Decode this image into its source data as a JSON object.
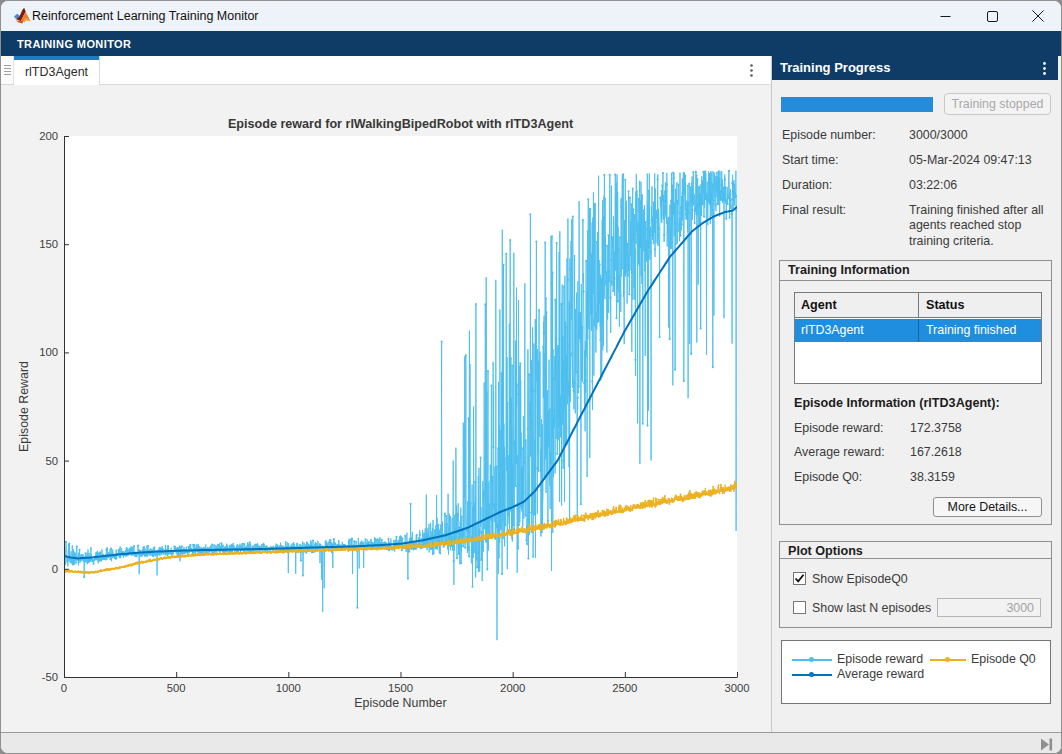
{
  "window": {
    "title": "Reinforcement Learning Training Monitor"
  },
  "toolstrip": {
    "tab_label": "TRAINING MONITOR"
  },
  "document_tab": {
    "label": "rlTD3Agent"
  },
  "right_panel": {
    "header": "Training Progress",
    "progress": {
      "percent": 100,
      "button_label": "Training stopped"
    },
    "fields": [
      {
        "label": "Episode number:",
        "value": "3000/3000"
      },
      {
        "label": "Start time:",
        "value": "05-Mar-2024 09:47:13"
      },
      {
        "label": "Duration:",
        "value": "03:22:06"
      },
      {
        "label": "Final result:",
        "value": "Training finished after all agents reached stop training criteria."
      }
    ],
    "training_information": {
      "title": "Training Information",
      "table": {
        "columns": [
          "Agent",
          "Status"
        ],
        "rows": [
          {
            "agent": "rlTD3Agent",
            "status": "Training finished",
            "selected": true
          }
        ]
      },
      "episode_info_title": "Episode Information (rlTD3Agent):",
      "stats": [
        {
          "label": "Episode reward:",
          "value": "172.3758"
        },
        {
          "label": "Average reward:",
          "value": "167.2618"
        },
        {
          "label": "Episode Q0:",
          "value": "38.3159"
        }
      ],
      "more_details_label": "More Details..."
    },
    "plot_options": {
      "title": "Plot Options",
      "show_episode_q0": {
        "label": "Show EpisodeQ0",
        "checked": true
      },
      "show_last_n": {
        "label": "Show last N episodes",
        "checked": false,
        "value": "3000"
      }
    },
    "legend": [
      {
        "label": "Episode reward",
        "color": "#4DBEEE"
      },
      {
        "label": "Episode Q0",
        "color": "#EDB120"
      },
      {
        "label": "Average reward",
        "color": "#0072BD"
      }
    ]
  },
  "colors": {
    "toolstrip_navy": "#0e3c66",
    "tab_accent": "#1d7dc2",
    "progress_blue": "#268cda",
    "selection_blue": "#1f8ede"
  },
  "chart_data": {
    "type": "line",
    "title": "Episode reward for rlWalkingBipedRobot with rlTD3Agent",
    "xlabel": "Episode Number",
    "ylabel": "Episode Reward",
    "xlim": [
      0,
      3000
    ],
    "ylim": [
      -50,
      200
    ],
    "xticks": [
      0,
      500,
      1000,
      1500,
      2000,
      2500,
      3000
    ],
    "yticks": [
      -50,
      0,
      50,
      100,
      150,
      200
    ],
    "grid": false,
    "legend_position": "external-panel",
    "series": [
      {
        "name": "Episode reward",
        "color": "#4DBEEE",
        "style": "noisy-line-with-dot-markers",
        "seed": 20240305,
        "base": [
          [
            0,
            6
          ],
          [
            60,
            4.5
          ],
          [
            150,
            5
          ],
          [
            300,
            7
          ],
          [
            500,
            8
          ],
          [
            800,
            9
          ],
          [
            1100,
            9.5
          ],
          [
            1400,
            10.5
          ],
          [
            1550,
            11
          ],
          [
            1650,
            12
          ],
          [
            1750,
            14
          ],
          [
            1850,
            17
          ],
          [
            1950,
            24
          ],
          [
            2050,
            36
          ],
          [
            2150,
            58
          ],
          [
            2250,
            90
          ],
          [
            2350,
            120
          ],
          [
            2450,
            138
          ],
          [
            2550,
            150
          ],
          [
            2650,
            160
          ],
          [
            2750,
            166
          ],
          [
            2850,
            170
          ],
          [
            3000,
            173
          ]
        ],
        "noise_amp": [
          [
            0,
            4
          ],
          [
            80,
            2.2
          ],
          [
            400,
            1.5
          ],
          [
            800,
            1.4
          ],
          [
            1100,
            1.7
          ],
          [
            1400,
            1.9
          ],
          [
            1600,
            3.0
          ],
          [
            1700,
            7
          ],
          [
            1800,
            12
          ],
          [
            1900,
            18
          ],
          [
            2000,
            26
          ],
          [
            2100,
            31
          ],
          [
            2200,
            32
          ],
          [
            2300,
            30
          ],
          [
            2400,
            28
          ],
          [
            2500,
            23
          ],
          [
            2600,
            17
          ],
          [
            2700,
            13
          ],
          [
            2800,
            11
          ],
          [
            2900,
            9
          ],
          [
            3000,
            8
          ]
        ],
        "top_envelope": [
          [
            0,
            25
          ],
          [
            1500,
            40
          ],
          [
            1600,
            42
          ],
          [
            1700,
            52
          ],
          [
            1770,
            92
          ],
          [
            1830,
            122
          ],
          [
            1880,
            146
          ],
          [
            1930,
            156
          ],
          [
            2000,
            164
          ],
          [
            2070,
            172
          ],
          [
            2150,
            176
          ],
          [
            2250,
            179
          ],
          [
            2400,
            182
          ],
          [
            2700,
            183
          ],
          [
            3000,
            184
          ]
        ],
        "up_spike_prob": [
          [
            0,
            0
          ],
          [
            1600,
            0
          ],
          [
            1650,
            0.02
          ],
          [
            1750,
            0.06
          ],
          [
            1820,
            0.11
          ],
          [
            1870,
            0.15
          ],
          [
            1950,
            0.17
          ],
          [
            2050,
            0.17
          ],
          [
            2150,
            0.1
          ],
          [
            2250,
            0.05
          ],
          [
            2400,
            0.015
          ],
          [
            3000,
            0.01
          ]
        ],
        "down_spike_prob": [
          [
            0,
            0.002
          ],
          [
            900,
            0.002
          ],
          [
            1000,
            0.0025
          ],
          [
            1600,
            0.01
          ],
          [
            1700,
            0.03
          ],
          [
            1800,
            0.05
          ],
          [
            2000,
            0.07
          ],
          [
            2100,
            0.1
          ],
          [
            2300,
            0.09
          ],
          [
            2400,
            0.055
          ],
          [
            2500,
            0.05
          ],
          [
            2700,
            0.035
          ],
          [
            3000,
            0.035
          ]
        ],
        "down_spike_depth": [
          [
            0,
            9
          ],
          [
            1000,
            14
          ],
          [
            1600,
            16
          ],
          [
            1800,
            25
          ],
          [
            2000,
            28
          ],
          [
            2100,
            60
          ],
          [
            2200,
            70
          ],
          [
            2300,
            85
          ],
          [
            2400,
            97
          ],
          [
            2500,
            105
          ],
          [
            2600,
            107
          ],
          [
            2800,
            105
          ],
          [
            3000,
            112
          ]
        ],
        "deep_spike_prob": [
          [
            0,
            0
          ],
          [
            1840,
            0
          ],
          [
            1850,
            0.005
          ],
          [
            2150,
            0.005
          ],
          [
            2160,
            0.001
          ],
          [
            2500,
            0.001
          ],
          [
            3000,
            0
          ]
        ],
        "anchors": [
          [
            0,
            22
          ],
          [
            1,
            -5
          ],
          [
            2,
            15
          ],
          [
            3,
            2
          ],
          [
            4,
            10
          ],
          [
            335,
            -2.5
          ],
          [
            415,
            -3
          ],
          [
            1000,
            -2
          ],
          [
            1148,
            -5
          ],
          [
            1153,
            -20
          ],
          [
            1160,
            -9
          ],
          [
            1308,
            -18
          ],
          [
            1545,
            30
          ],
          [
            1683,
            105
          ],
          [
            1735,
            50
          ],
          [
            1930,
            -33
          ],
          [
            2996,
            17.5
          ],
          [
            3000,
            172.3758
          ]
        ]
      },
      {
        "name": "Episode Q0",
        "color": "#EDB120",
        "style": "noisy-line-with-dot-markers",
        "seed": 991,
        "base": [
          [
            0,
            -1
          ],
          [
            120,
            -1.8
          ],
          [
            250,
            0.5
          ],
          [
            350,
            3
          ],
          [
            450,
            5
          ],
          [
            600,
            6.5
          ],
          [
            800,
            7.2
          ],
          [
            1000,
            8
          ],
          [
            1200,
            8.7
          ],
          [
            1400,
            9.3
          ],
          [
            1600,
            10.4
          ],
          [
            1700,
            11.4
          ],
          [
            1800,
            13
          ],
          [
            1900,
            14.6
          ],
          [
            2000,
            16.5
          ],
          [
            2100,
            18.5
          ],
          [
            2200,
            20.7
          ],
          [
            2300,
            23
          ],
          [
            2400,
            25.2
          ],
          [
            2500,
            27.4
          ],
          [
            2600,
            29.4
          ],
          [
            2700,
            31.4
          ],
          [
            2800,
            33.4
          ],
          [
            2900,
            35.4
          ],
          [
            3000,
            37.8
          ]
        ],
        "noise_amp": [
          [
            0,
            0.25
          ],
          [
            1400,
            0.35
          ],
          [
            1700,
            0.7
          ],
          [
            2000,
            1.0
          ],
          [
            2400,
            1.2
          ],
          [
            3000,
            1.3
          ]
        ],
        "anchors": [
          [
            3000,
            38.3159
          ]
        ]
      },
      {
        "name": "Average reward",
        "color": "#0072BD",
        "style": "smooth-line",
        "points": [
          [
            0,
            6
          ],
          [
            30,
            5.2
          ],
          [
            60,
            4.8
          ],
          [
            120,
            5.2
          ],
          [
            200,
            6.2
          ],
          [
            300,
            7.2
          ],
          [
            400,
            7.9
          ],
          [
            500,
            8.3
          ],
          [
            600,
            8.6
          ],
          [
            700,
            8.8
          ],
          [
            800,
            9.0
          ],
          [
            900,
            9.2
          ],
          [
            1000,
            9.5
          ],
          [
            1100,
            9.8
          ],
          [
            1200,
            10.1
          ],
          [
            1300,
            10.4
          ],
          [
            1400,
            10.9
          ],
          [
            1500,
            11.6
          ],
          [
            1600,
            13.2
          ],
          [
            1700,
            15.5
          ],
          [
            1800,
            19
          ],
          [
            1850,
            21.5
          ],
          [
            1900,
            24
          ],
          [
            1950,
            26.5
          ],
          [
            2000,
            28.5
          ],
          [
            2050,
            31
          ],
          [
            2100,
            36
          ],
          [
            2150,
            43
          ],
          [
            2200,
            50
          ],
          [
            2250,
            60
          ],
          [
            2300,
            70
          ],
          [
            2350,
            80
          ],
          [
            2400,
            90
          ],
          [
            2450,
            100
          ],
          [
            2500,
            110
          ],
          [
            2550,
            119
          ],
          [
            2600,
            128
          ],
          [
            2650,
            136
          ],
          [
            2700,
            144
          ],
          [
            2750,
            150
          ],
          [
            2800,
            156
          ],
          [
            2850,
            160
          ],
          [
            2900,
            163
          ],
          [
            2950,
            165
          ],
          [
            2980,
            165.5
          ],
          [
            3000,
            167.2618
          ]
        ]
      }
    ]
  }
}
